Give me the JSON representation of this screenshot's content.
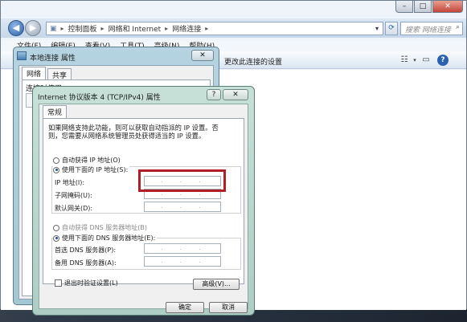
{
  "explorer": {
    "breadcrumb": [
      "控制面板",
      "网络和 Internet",
      "网络连接"
    ],
    "search_placeholder": "搜索 网络连接",
    "menu": [
      "文件(F)",
      "编辑(E)",
      "查看(V)",
      "工具(T)",
      "高级(N)",
      "帮助(H)"
    ],
    "toolbar_action": "更改此连接的设置",
    "caption_buttons": {
      "minimize": "–",
      "maximize": "□",
      "close": "✕"
    }
  },
  "local_props": {
    "title": "本地连接 属性",
    "tabs": [
      "网络",
      "共享"
    ],
    "connect_using_label": "连接时使用:",
    "close_label": "✕"
  },
  "ipv4": {
    "title": "Internet 协议版本 4 (TCP/IPv4) 属性",
    "help_label": "?",
    "close_label": "✕",
    "tab": "常规",
    "description": "如果网络支持此功能，则可以获取自动指派的 IP 设置。否则，您需要从网络系统管理员处获得适当的 IP 设置。",
    "ip_auto": "自动获得 IP 地址(O)",
    "ip_manual": "使用下面的 IP 地址(S):",
    "ip_address_label": "IP 地址(I):",
    "subnet_label": "子网掩码(U):",
    "gateway_label": "默认网关(D):",
    "dns_auto": "自动获得 DNS 服务器地址(B)",
    "dns_manual": "使用下面的 DNS 服务器地址(E):",
    "dns_preferred_label": "首选 DNS 服务器(P):",
    "dns_alternate_label": "备用 DNS 服务器(A):",
    "validate_label": "退出时验证设置(L)",
    "advanced_label": "高级(V)...",
    "ok_label": "确定",
    "cancel_label": "取消"
  }
}
